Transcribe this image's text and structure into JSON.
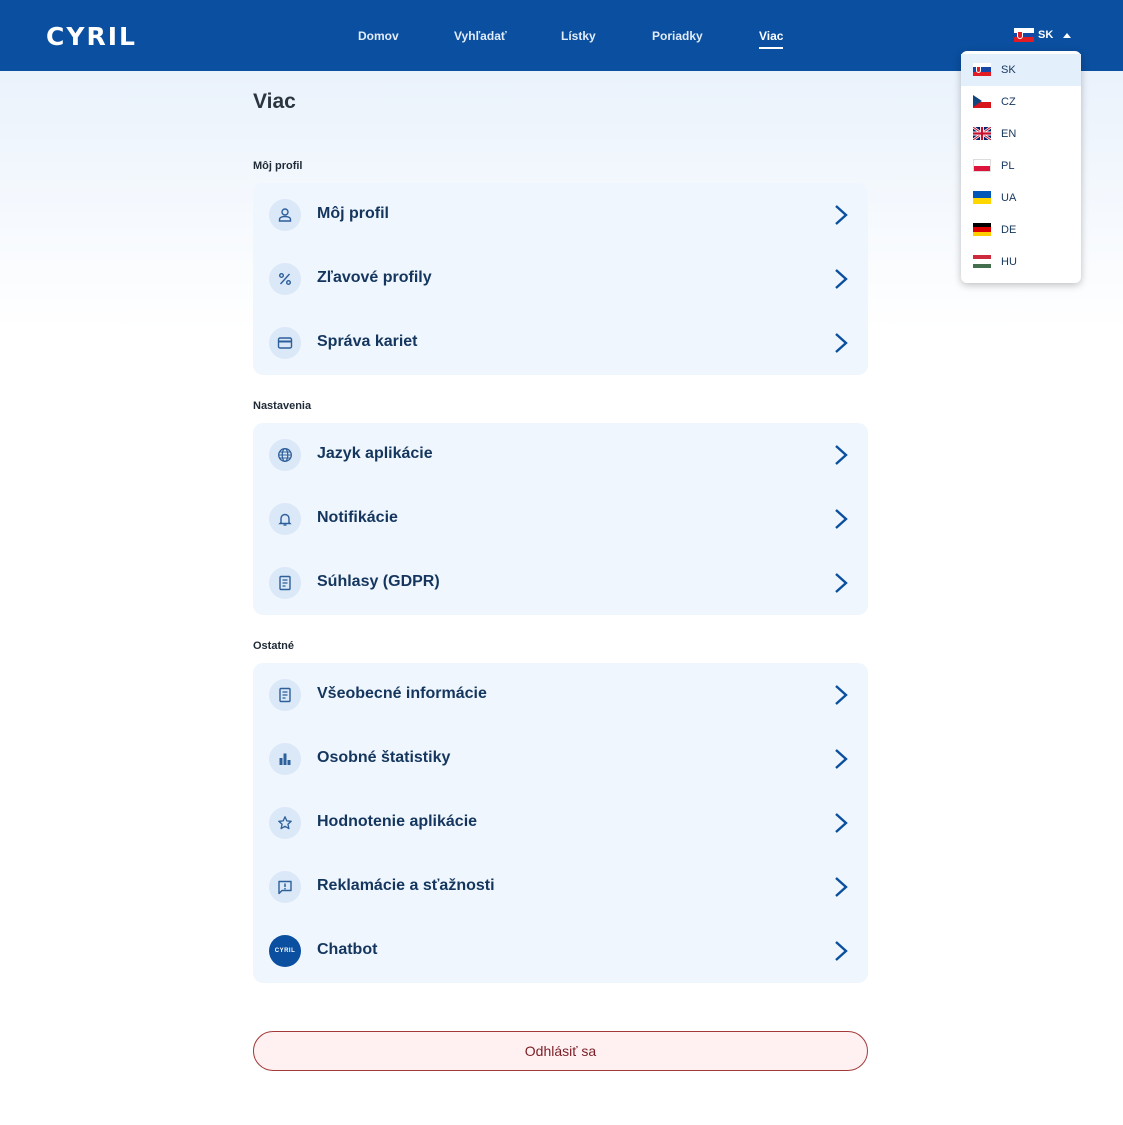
{
  "header": {
    "logo": "CYRIL",
    "nav": [
      "Domov",
      "Vyhľadať",
      "Lístky",
      "Poriadky",
      "Viac"
    ],
    "active_nav": "Viac",
    "language": "SK"
  },
  "page": {
    "title": "Viac"
  },
  "sections": [
    {
      "title": "Môj profil",
      "items": [
        {
          "label": "Môj profil",
          "icon": "user-icon"
        },
        {
          "label": "Zľavové profily",
          "icon": "percent-icon"
        },
        {
          "label": "Správa kariet",
          "icon": "card-icon"
        }
      ]
    },
    {
      "title": "Nastavenia",
      "items": [
        {
          "label": "Jazyk aplikácie",
          "icon": "globe-icon"
        },
        {
          "label": "Notifikácie",
          "icon": "bell-icon"
        },
        {
          "label": "Súhlasy (GDPR)",
          "icon": "document-icon"
        }
      ]
    },
    {
      "title": "Ostatné",
      "items": [
        {
          "label": "Všeobecné informácie",
          "icon": "document-icon"
        },
        {
          "label": "Osobné štatistiky",
          "icon": "bar-chart-icon"
        },
        {
          "label": "Hodnotenie aplikácie",
          "icon": "star-icon"
        },
        {
          "label": "Reklamácie a sťažnosti",
          "icon": "feedback-icon"
        },
        {
          "label": "Chatbot",
          "icon": "cyril-logo-icon",
          "icon_text": "CYRIL"
        }
      ]
    }
  ],
  "logout_label": "Odhlásiť sa",
  "language_dropdown": {
    "selected": "SK",
    "options": [
      "SK",
      "CZ",
      "EN",
      "PL",
      "UA",
      "DE",
      "HU"
    ]
  },
  "colors": {
    "header_bg": "#0b4fa0",
    "card_bg": "#eff6fd",
    "text_primary": "#14365e",
    "logout_border": "#a33a3a"
  }
}
